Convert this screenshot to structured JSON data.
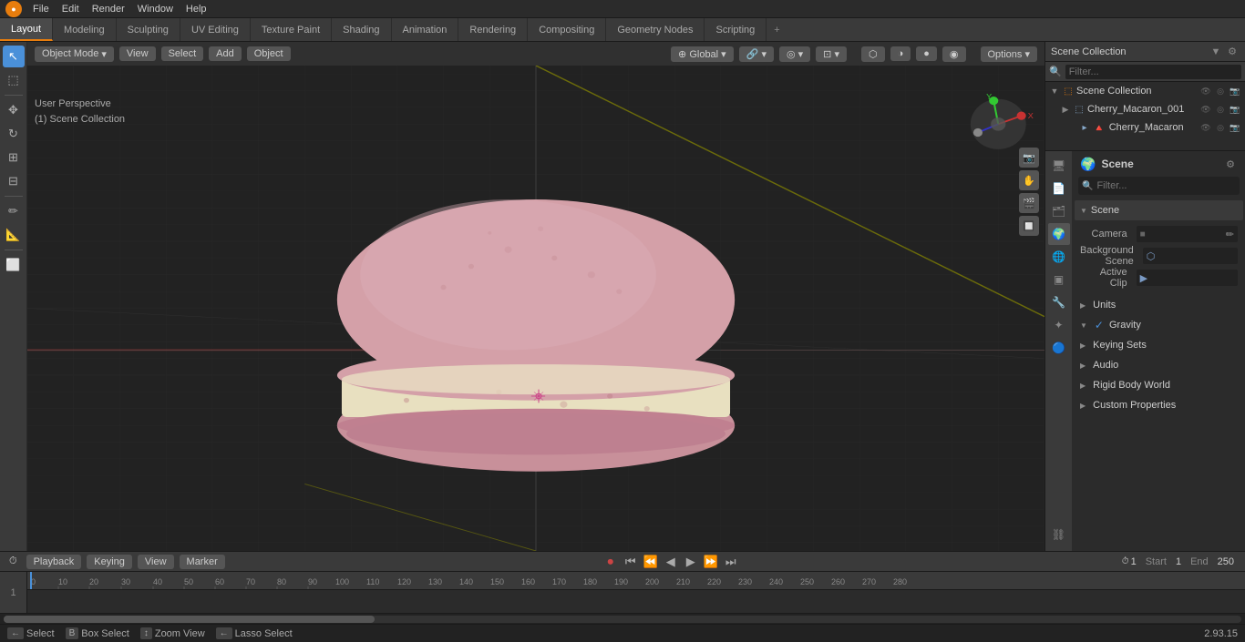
{
  "app": {
    "title": "Blender",
    "version": "2.93.15"
  },
  "menu": {
    "items": [
      "File",
      "Edit",
      "Render",
      "Window",
      "Help"
    ]
  },
  "workspace_tabs": [
    {
      "label": "Layout",
      "active": true
    },
    {
      "label": "Modeling"
    },
    {
      "label": "Sculpting"
    },
    {
      "label": "UV Editing"
    },
    {
      "label": "Texture Paint"
    },
    {
      "label": "Shading"
    },
    {
      "label": "Animation"
    },
    {
      "label": "Rendering"
    },
    {
      "label": "Compositing"
    },
    {
      "label": "Geometry Nodes"
    },
    {
      "label": "Scripting"
    }
  ],
  "viewport_header": {
    "mode": "Object Mode",
    "view": "View",
    "select": "Select",
    "add": "Add",
    "object": "Object",
    "transform": "Global",
    "options": "Options ▾"
  },
  "viewport_info": {
    "line1": "User Perspective",
    "line2": "(1) Scene Collection"
  },
  "outliner": {
    "title": "Scene Collection",
    "items": [
      {
        "name": "Cherry_Macaron_001",
        "depth": 1,
        "icon": "▶",
        "expanded": false
      },
      {
        "name": "Cherry_Macaron",
        "depth": 2,
        "icon": "▸",
        "expanded": false
      }
    ]
  },
  "properties": {
    "active_tab": "scene",
    "header_label": "Scene",
    "scene_section": {
      "label": "Scene",
      "camera_label": "Camera",
      "camera_value": "",
      "background_scene_label": "Background Scene",
      "active_clip_label": "Active Clip"
    },
    "sections": [
      {
        "label": "Units",
        "collapsed": true
      },
      {
        "label": "Gravity",
        "collapsed": false,
        "checkbox": true
      },
      {
        "label": "Keying Sets",
        "collapsed": true
      },
      {
        "label": "Audio",
        "collapsed": true
      },
      {
        "label": "Rigid Body World",
        "collapsed": true
      },
      {
        "label": "Custom Properties",
        "collapsed": true
      }
    ],
    "tabs": [
      {
        "icon": "🖥",
        "label": "render",
        "active": false
      },
      {
        "icon": "📄",
        "label": "output",
        "active": false
      },
      {
        "icon": "👁",
        "label": "view_layer",
        "active": false
      },
      {
        "icon": "🌍",
        "label": "scene",
        "active": true
      },
      {
        "icon": "🌐",
        "label": "world",
        "active": false
      },
      {
        "icon": "▣",
        "label": "object",
        "active": false
      },
      {
        "icon": "⚙",
        "label": "modifier",
        "active": false
      },
      {
        "icon": "✦",
        "label": "particles",
        "active": false
      },
      {
        "icon": "🔮",
        "label": "physics",
        "active": false
      }
    ]
  },
  "timeline": {
    "playback_label": "Playback",
    "keying_label": "Keying",
    "view_label": "View",
    "marker_label": "Marker",
    "current_frame": "1",
    "start_label": "Start",
    "start_value": "1",
    "end_label": "End",
    "end_value": "250"
  },
  "status_bar": {
    "select_label": "Select",
    "select_key": "←",
    "box_select_label": "Box Select",
    "box_select_key": "B",
    "zoom_view_label": "Zoom View",
    "lasso_select_label": "Lasso Select",
    "version": "2.93.15"
  },
  "timeline_numbers": [
    0,
    10,
    20,
    30,
    40,
    50,
    60,
    70,
    80,
    90,
    100,
    110,
    120,
    130,
    140,
    150,
    160,
    170,
    180,
    190,
    200,
    210,
    220,
    230,
    240,
    250,
    260,
    270,
    280
  ]
}
